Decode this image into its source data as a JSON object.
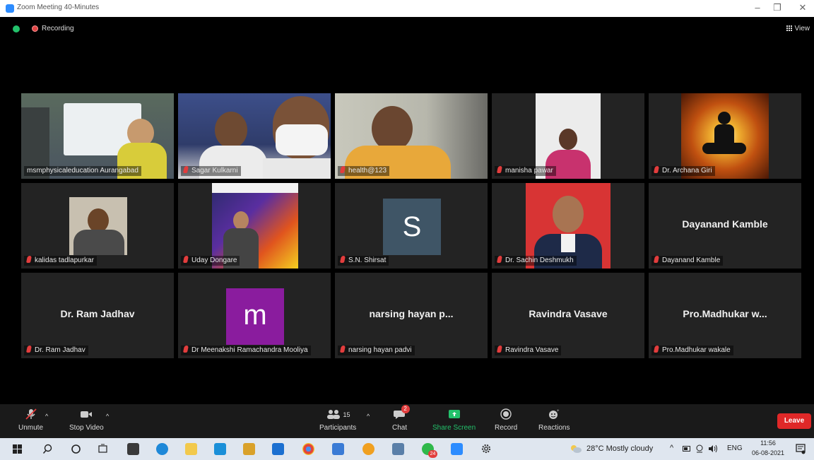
{
  "window": {
    "title": "Zoom Meeting 40-Minutes"
  },
  "topbar": {
    "recording_label": "Recording",
    "view_label": "View"
  },
  "participants": {
    "row1": [
      {
        "name": "msmphysicaleducation Aurangabad"
      },
      {
        "name": "Sagar Kulkarni"
      },
      {
        "name": "health@123"
      },
      {
        "name": "manisha pawar"
      },
      {
        "name": "Dr. Archana Giri"
      }
    ],
    "row2": [
      {
        "name": "kalidas tadlapurkar"
      },
      {
        "name": "Uday Dongare"
      },
      {
        "name": "S.N. Shirsat",
        "avatar_letter": "S",
        "avatar_color": "#3f5566"
      },
      {
        "name": "Dr. Sachin Deshmukh"
      },
      {
        "name": "Dayanand Kamble",
        "display_text": "Dayanand Kamble"
      }
    ],
    "row3": [
      {
        "name": "Dr. Ram Jadhav",
        "display_text": "Dr. Ram Jadhav"
      },
      {
        "name": "Dr Meenakshi Ramachandra Mooliya",
        "avatar_letter": "m",
        "avatar_color": "#8a1c9e"
      },
      {
        "name": "narsing hayan padvi",
        "display_text": "narsing hayan p..."
      },
      {
        "name": "Ravindra Vasave",
        "display_text": "Ravindra Vasave"
      },
      {
        "name": "Pro.Madhukar wakale",
        "display_text": "Pro.Madhukar w..."
      }
    ]
  },
  "toolbar": {
    "unmute": "Unmute",
    "stop_video": "Stop Video",
    "participants": "Participants",
    "participants_count": "15",
    "chat": "Chat",
    "chat_badge": "2",
    "share_screen": "Share Screen",
    "record": "Record",
    "reactions": "Reactions",
    "leave": "Leave"
  },
  "taskbar": {
    "weather": "28°C  Mostly cloudy",
    "language": "ENG",
    "time": "11:56",
    "date": "06-08-2021",
    "whatsapp_badge": "24"
  },
  "colors": {
    "active_speaker": "#d4e157",
    "leave": "#e02828",
    "share_screen": "#23c16b",
    "zoom_blue": "#2d8cff"
  }
}
